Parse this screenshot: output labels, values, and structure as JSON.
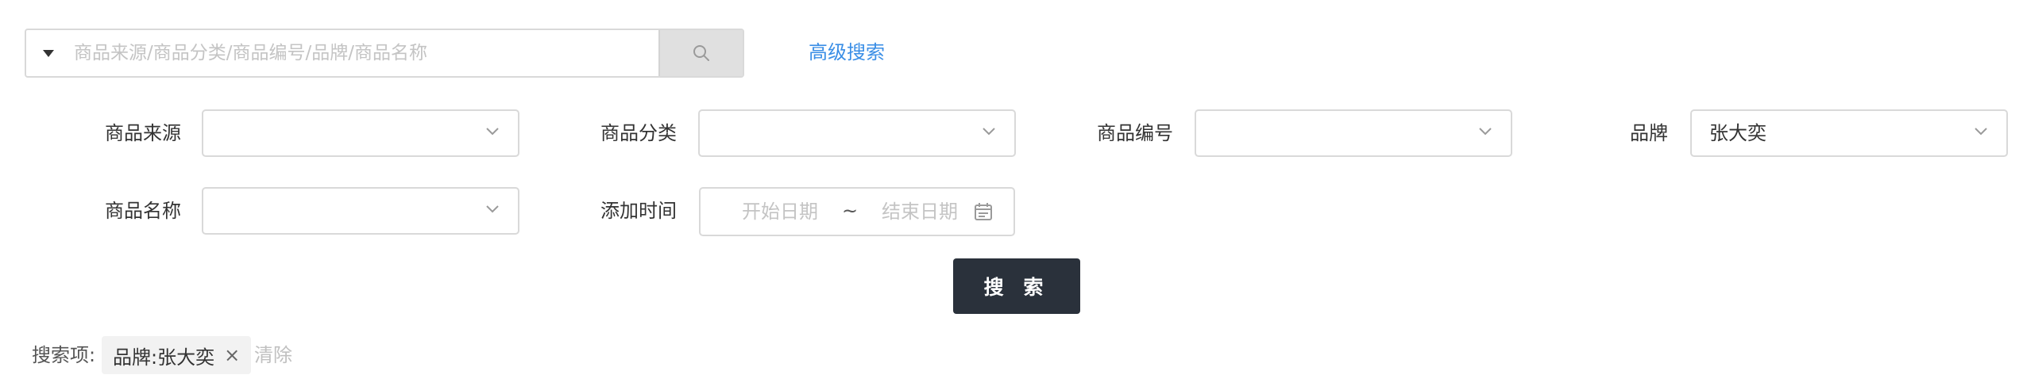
{
  "search": {
    "placeholder": "商品来源/商品分类/商品编号/品牌/商品名称",
    "value": ""
  },
  "advanced_search_label": "高级搜索",
  "filters": {
    "source": {
      "label": "商品来源",
      "value": ""
    },
    "category": {
      "label": "商品分类",
      "value": ""
    },
    "code": {
      "label": "商品编号",
      "value": ""
    },
    "brand": {
      "label": "品牌",
      "value": "张大奕"
    },
    "name": {
      "label": "商品名称",
      "value": ""
    },
    "added_time": {
      "label": "添加时间",
      "start_placeholder": "开始日期",
      "separator": "~",
      "end_placeholder": "结束日期"
    }
  },
  "submit_label": "搜 索",
  "search_terms": {
    "label": "搜索项:",
    "tags": [
      {
        "text": "品牌:张大奕",
        "close": "×"
      }
    ],
    "clear_label": "清除"
  },
  "colors": {
    "link": "#3a8ee6",
    "primary_button": "#2a313b",
    "border": "#d9d9d9",
    "placeholder": "#c4c4c4"
  },
  "icons": {
    "scope": "caret-down-icon",
    "search": "search-icon",
    "select": "chevron-down-icon",
    "date": "calendar-icon"
  }
}
